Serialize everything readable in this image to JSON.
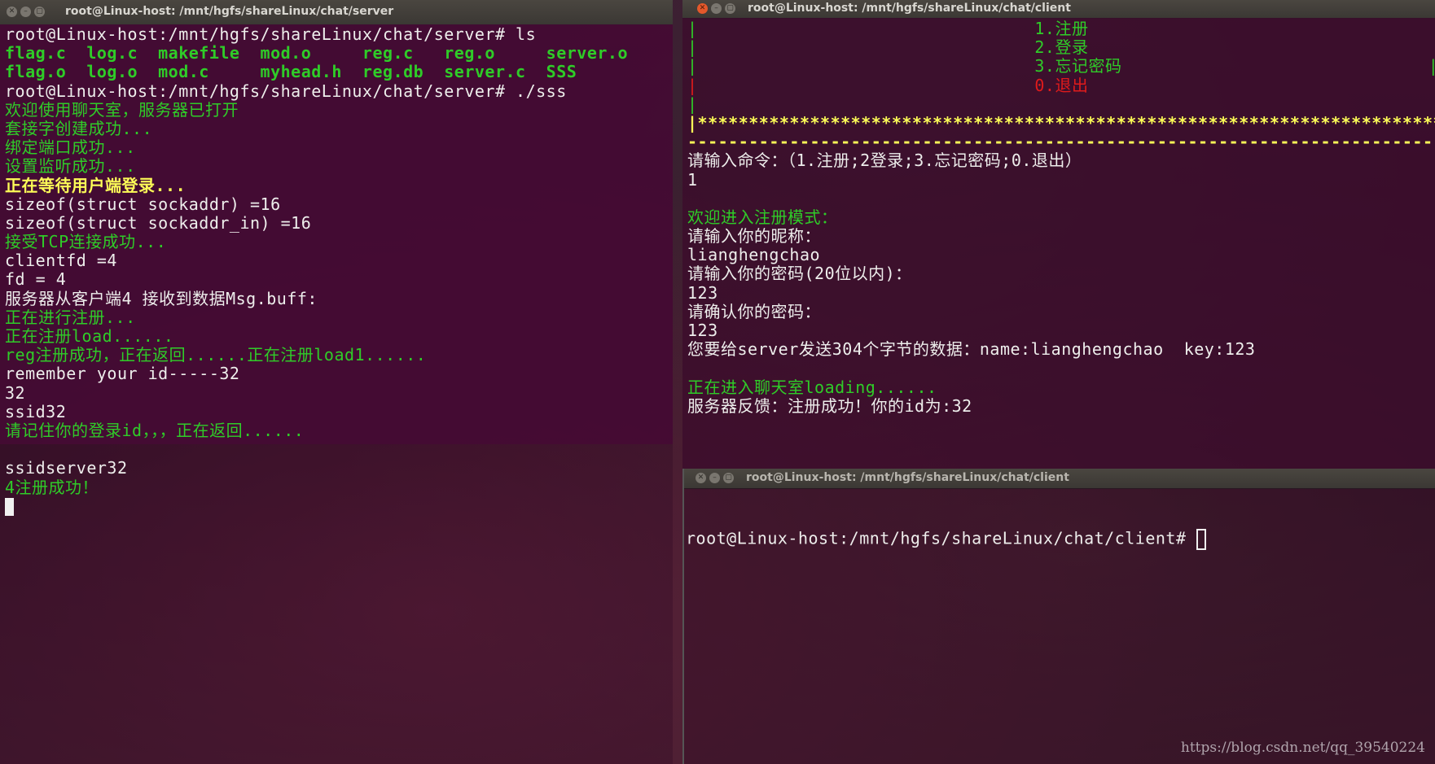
{
  "server_window": {
    "title": "root@Linux-host: /mnt/hgfs/shareLinux/chat/server",
    "lines": [
      {
        "t": "root@Linux-host:/mnt/hgfs/shareLinux/chat/server# ls",
        "c": ""
      },
      {
        "t": "flag.c  log.c  makefile  mod.o     reg.c   reg.o     server.o",
        "c": "g b"
      },
      {
        "t": "flag.o  log.o  mod.c     myhead.h  reg.db  server.c  SSS",
        "c": "g b"
      },
      {
        "t": "root@Linux-host:/mnt/hgfs/shareLinux/chat/server# ./sss",
        "c": ""
      },
      {
        "t": "欢迎使用聊天室，服务器已打开",
        "c": "g"
      },
      {
        "t": "套接字创建成功...",
        "c": "g"
      },
      {
        "t": "绑定端口成功...",
        "c": "g"
      },
      {
        "t": "设置监听成功...",
        "c": "g"
      },
      {
        "t": "正在等待用户端登录...",
        "c": "y"
      },
      {
        "t": "sizeof(struct sockaddr) =16",
        "c": ""
      },
      {
        "t": "sizeof(struct sockaddr_in) =16",
        "c": ""
      },
      {
        "t": "接受TCP连接成功...",
        "c": "g"
      },
      {
        "t": "clientfd =4",
        "c": ""
      },
      {
        "t": "fd = 4",
        "c": ""
      },
      {
        "t": "服务器从客户端4 接收到数据Msg.buff:",
        "c": ""
      },
      {
        "t": "正在进行注册...",
        "c": "g"
      },
      {
        "t": "正在注册load......",
        "c": "g"
      },
      {
        "t": "reg注册成功，正在返回......正在注册load1......",
        "c": "g"
      },
      {
        "t": "remember your id-----32",
        "c": ""
      },
      {
        "t": "32",
        "c": ""
      },
      {
        "t": "ssid32",
        "c": ""
      },
      {
        "t": "请记住你的登录id，，，正在返回......",
        "c": "g"
      },
      {
        "t": "",
        "c": ""
      },
      {
        "t": "ssidserver32",
        "c": ""
      },
      {
        "t": "4注册成功！",
        "c": "g"
      }
    ]
  },
  "client_window": {
    "title": "root@Linux-host: /mnt/hgfs/shareLinux/chat/client",
    "lines": [
      {
        "t": "|                                 1.注册                                  |",
        "c": "g"
      },
      {
        "t": "|                                 2.登录                                  |",
        "c": "g"
      },
      {
        "t": "|                                 3.忘记密码                              |",
        "c": "g"
      },
      {
        "t": "|                                 0.退出                                  |",
        "c": "r"
      },
      {
        "t": "|                                                                         |",
        "c": "g"
      },
      {
        "t": "|*****************************************************************************|",
        "c": "y"
      },
      {
        "t": "-----------------------------------------------------------------------------",
        "c": "y"
      },
      {
        "t": "请输入命令：（1.注册;2登录;3.忘记密码;0.退出）",
        "c": ""
      },
      {
        "t": "1",
        "c": ""
      },
      {
        "t": "",
        "c": ""
      },
      {
        "t": "欢迎进入注册模式：",
        "c": "g"
      },
      {
        "t": "请输入你的昵称：",
        "c": ""
      },
      {
        "t": "lianghengchao",
        "c": ""
      },
      {
        "t": "请输入你的密码(20位以内)：",
        "c": ""
      },
      {
        "t": "123",
        "c": ""
      },
      {
        "t": "请确认你的密码：",
        "c": ""
      },
      {
        "t": "123",
        "c": ""
      },
      {
        "t": "您要给server发送304个字节的数据：name:lianghengchao  key:123",
        "c": ""
      },
      {
        "t": "",
        "c": ""
      },
      {
        "t": "正在进入聊天室loading......",
        "c": "g"
      },
      {
        "t": "服务器反馈：注册成功！你的id为:32",
        "c": ""
      }
    ]
  },
  "client2_window": {
    "title": "root@Linux-host: /mnt/hgfs/shareLinux/chat/client",
    "prompt": "root@Linux-host:/mnt/hgfs/shareLinux/chat/client# "
  },
  "watermark": "https://blog.csdn.net/qq_39540224"
}
